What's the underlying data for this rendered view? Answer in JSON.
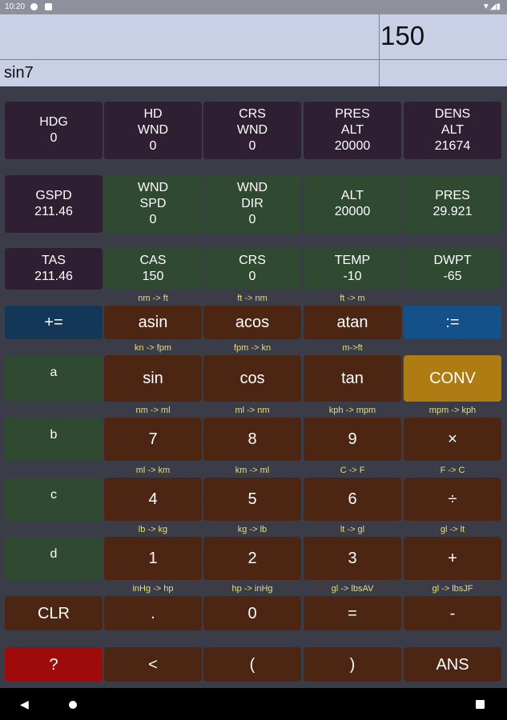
{
  "status": {
    "time": "10:20",
    "icons": [
      "g-icon",
      "doc-icon",
      "wifi-icon",
      "signal-icon",
      "battery-icon"
    ],
    "right_glyphs": "▼◢▮"
  },
  "display": {
    "result": "150",
    "expression": "sin7"
  },
  "rows": [
    [
      {
        "name": "hdg-cell",
        "lines": [
          "HDG",
          "0"
        ],
        "color": "#2e1f33"
      },
      {
        "name": "hd-wnd-cell",
        "lines": [
          "HD",
          "WND",
          "0"
        ],
        "color": "#2e1f33"
      },
      {
        "name": "crs-wnd-cell",
        "lines": [
          "CRS",
          "WND",
          "0"
        ],
        "color": "#2e1f33"
      },
      {
        "name": "pres-alt-cell",
        "lines": [
          "PRES",
          "ALT",
          "20000"
        ],
        "color": "#2e1f33"
      },
      {
        "name": "dens-alt-cell",
        "lines": [
          "DENS",
          "ALT",
          "21674"
        ],
        "color": "#2e1f33"
      }
    ],
    [
      {
        "name": "gspd-cell",
        "lines": [
          "GSPD",
          "211.46"
        ],
        "color": "#2e1f33"
      },
      {
        "name": "wnd-spd-cell",
        "lines": [
          "WND",
          "SPD",
          "0"
        ],
        "color": "#2f4a31"
      },
      {
        "name": "wnd-dir-cell",
        "lines": [
          "WND",
          "DIR",
          "0"
        ],
        "color": "#2f4a31"
      },
      {
        "name": "alt-cell",
        "lines": [
          "ALT",
          "20000"
        ],
        "color": "#2f4a31"
      },
      {
        "name": "pres-cell",
        "lines": [
          "PRES",
          "29.921"
        ],
        "color": "#2f4a31"
      }
    ],
    [
      {
        "name": "tas-cell",
        "lines": [
          "TAS",
          "211.46"
        ],
        "color": "#2e1f33"
      },
      {
        "name": "cas-cell",
        "lines": [
          "CAS",
          "150"
        ],
        "color": "#2f4a31"
      },
      {
        "name": "crs-cell",
        "lines": [
          "CRS",
          "0"
        ],
        "color": "#2f4a31"
      },
      {
        "name": "temp-cell",
        "lines": [
          "TEMP",
          "-10"
        ],
        "color": "#2f4a31"
      },
      {
        "name": "dwpt-cell",
        "lines": [
          "DWPT",
          "-65"
        ],
        "color": "#2f4a31"
      }
    ],
    [
      {
        "name": "plus-equals-button",
        "label": "+=",
        "color": "#123757"
      },
      {
        "name": "asin-button",
        "label": "asin",
        "sub": "nm -> ft",
        "color": "#4c2513"
      },
      {
        "name": "acos-button",
        "label": "acos",
        "sub": "ft -> nm",
        "color": "#4c2513"
      },
      {
        "name": "atan-button",
        "label": "atan",
        "sub": "ft -> m",
        "color": "#4c2513"
      },
      {
        "name": "assign-button",
        "label": ":=",
        "color": "#14508a"
      }
    ],
    [
      {
        "name": "var-a-button",
        "label": "a",
        "color": "#2f4a31",
        "small": true
      },
      {
        "name": "sin-button",
        "label": "sin",
        "sub": "kn -> fpm",
        "color": "#4c2513"
      },
      {
        "name": "cos-button",
        "label": "cos",
        "sub": "fpm -> kn",
        "color": "#4c2513"
      },
      {
        "name": "tan-button",
        "label": "tan",
        "sub": "m->ft",
        "color": "#4c2513"
      },
      {
        "name": "conv-button",
        "label": "CONV",
        "color": "#ae7c12"
      }
    ],
    [
      {
        "name": "var-b-button",
        "label": "b",
        "color": "#2f4a31",
        "small": true
      },
      {
        "name": "digit-7-button",
        "label": "7",
        "sub": "nm -> ml",
        "color": "#4c2513"
      },
      {
        "name": "digit-8-button",
        "label": "8",
        "sub": "ml -> nm",
        "color": "#4c2513"
      },
      {
        "name": "digit-9-button",
        "label": "9",
        "sub": "kph -> mpm",
        "color": "#4c2513"
      },
      {
        "name": "multiply-button",
        "label": "×",
        "sub": "mpm -> kph",
        "color": "#4c2513"
      }
    ],
    [
      {
        "name": "var-c-button",
        "label": "c",
        "color": "#2f4a31",
        "small": true
      },
      {
        "name": "digit-4-button",
        "label": "4",
        "sub": "ml -> km",
        "color": "#4c2513"
      },
      {
        "name": "digit-5-button",
        "label": "5",
        "sub": "km -> ml",
        "color": "#4c2513"
      },
      {
        "name": "digit-6-button",
        "label": "6",
        "sub": "C -> F",
        "color": "#4c2513"
      },
      {
        "name": "divide-button",
        "label": "÷",
        "sub": "F -> C",
        "color": "#4c2513"
      }
    ],
    [
      {
        "name": "var-d-button",
        "label": "d",
        "color": "#2f4a31",
        "small": true
      },
      {
        "name": "digit-1-button",
        "label": "1",
        "sub": "lb -> kg",
        "color": "#4c2513"
      },
      {
        "name": "digit-2-button",
        "label": "2",
        "sub": "kg -> lb",
        "color": "#4c2513"
      },
      {
        "name": "digit-3-button",
        "label": "3",
        "sub": "lt -> gl",
        "color": "#4c2513"
      },
      {
        "name": "plus-button",
        "label": "+",
        "sub": "gl -> lt",
        "color": "#4c2513"
      }
    ],
    [
      {
        "name": "clear-button",
        "label": "CLR",
        "color": "#4c2513"
      },
      {
        "name": "decimal-button",
        "label": ".",
        "sub": "inHg -> hp",
        "color": "#4c2513"
      },
      {
        "name": "digit-0-button",
        "label": "0",
        "sub": "hp -> inHg",
        "color": "#4c2513"
      },
      {
        "name": "equals-button",
        "label": "=",
        "sub": "gl -> lbsAV",
        "color": "#4c2513"
      },
      {
        "name": "minus-button",
        "label": "-",
        "sub": "gl -> lbsJF",
        "color": "#4c2513"
      }
    ],
    [
      {
        "name": "help-button",
        "label": "?",
        "color": "#9f0b0b"
      },
      {
        "name": "backspace-button",
        "label": "<",
        "color": "#4c2513"
      },
      {
        "name": "open-paren-button",
        "label": "(",
        "color": "#4c2513"
      },
      {
        "name": "close-paren-button",
        "label": ")",
        "color": "#4c2513"
      },
      {
        "name": "ans-button",
        "label": "ANS",
        "color": "#4c2513"
      }
    ]
  ],
  "nav": {
    "back": "◀"
  }
}
